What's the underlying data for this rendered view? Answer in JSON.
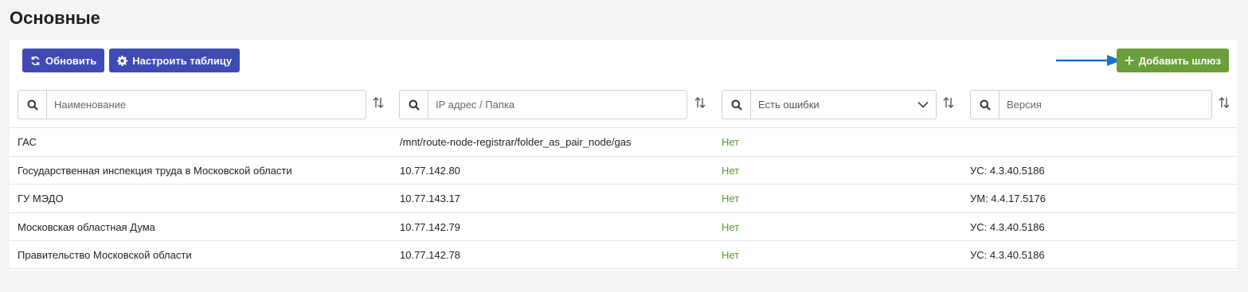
{
  "page": {
    "title": "Основные"
  },
  "toolbar": {
    "refresh_label": "Обновить",
    "configure_label": "Настроить таблицу",
    "add_gateway_label": "Добавить шлюз"
  },
  "filters": {
    "name": {
      "placeholder": "Наименование"
    },
    "ip": {
      "placeholder": "IP адрес / Папка"
    },
    "errors": {
      "selected": "Есть ошибки"
    },
    "version": {
      "placeholder": "Версия"
    }
  },
  "table": {
    "rows": [
      {
        "name": "ГАС",
        "ip": "/mnt/route-node-registrar/folder_as_pair_node/gas",
        "errors": "Нет",
        "version": ""
      },
      {
        "name": "Государственная инспекция труда в Московской области",
        "ip": "10.77.142.80",
        "errors": "Нет",
        "version": "УС: 4.3.40.5186"
      },
      {
        "name": "ГУ МЭДО",
        "ip": "10.77.143.17",
        "errors": "Нет",
        "version": "УМ: 4.4.17.5176"
      },
      {
        "name": "Московская областная Дума",
        "ip": "10.77.142.79",
        "errors": "Нет",
        "version": "УС: 4.3.40.5186"
      },
      {
        "name": "Правительство Московской области",
        "ip": "10.77.142.78",
        "errors": "Нет",
        "version": "УС: 4.3.40.5186"
      }
    ]
  },
  "icons": {
    "refresh": "refresh-icon",
    "gear": "gear-icon",
    "plus": "plus-icon",
    "search": "search-icon",
    "sort": "sort-icon",
    "chevron": "chevron-down-icon",
    "arrow": "arrow-right-icon"
  },
  "colors": {
    "primary": "#3f4bb3",
    "success": "#6a9f3b",
    "status_ok": "#5a9a2c",
    "arrow": "#1a6fd0"
  }
}
